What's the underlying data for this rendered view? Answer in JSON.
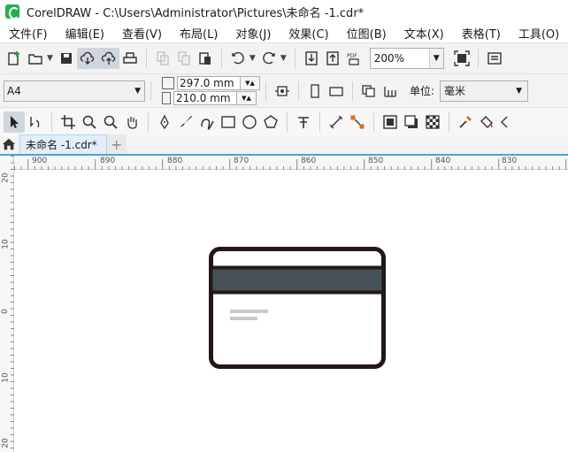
{
  "window": {
    "title": "CorelDRAW - C:\\Users\\Administrator\\Pictures\\未命名 -1.cdr*"
  },
  "menu": [
    "文件(F)",
    "编辑(E)",
    "查看(V)",
    "布局(L)",
    "对象(J)",
    "效果(C)",
    "位图(B)",
    "文本(X)",
    "表格(T)",
    "工具(O)"
  ],
  "toolbar": {
    "zoom_value": "200%",
    "pdf_label": "PDF"
  },
  "property_bar": {
    "paper_size": "A4",
    "width": "297.0 mm",
    "height": "210.0 mm",
    "unit_label": "单位:",
    "unit_value": "毫米"
  },
  "tabs": {
    "document": "未命名 -1.cdr*"
  },
  "ruler": {
    "horizontal": [
      "900",
      "890",
      "880",
      "870",
      "860",
      "850",
      "840",
      "830"
    ],
    "vertical": [
      "20",
      "10",
      "0",
      "10",
      "20"
    ]
  },
  "drawing": {
    "description_colors": {
      "outline": "#231815",
      "stripe": "#475159",
      "text_lines": "#c9c9c9"
    }
  }
}
